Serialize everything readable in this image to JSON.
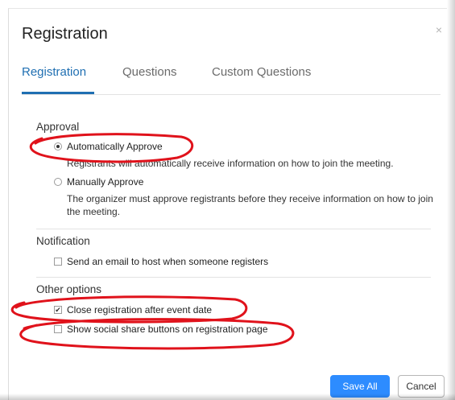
{
  "dialog": {
    "title": "Registration",
    "close_glyph": "×"
  },
  "tabs": [
    {
      "label": "Registration"
    },
    {
      "label": "Questions"
    },
    {
      "label": "Custom Questions"
    }
  ],
  "approval": {
    "label": "Approval",
    "auto": {
      "label": "Automatically Approve",
      "checked": true,
      "description": "Registrants will automatically receive information on how to join the meeting."
    },
    "manual": {
      "label": "Manually Approve",
      "checked": false,
      "description": "The organizer must approve registrants before they receive information on how to join the meeting."
    }
  },
  "notification": {
    "label": "Notification",
    "email_host": {
      "label": "Send an email to host when someone registers",
      "checked": false
    }
  },
  "other_options": {
    "label": "Other options",
    "close_registration": {
      "label": "Close registration after event date",
      "checked": true
    },
    "social_share": {
      "label": "Show social share buttons on registration page",
      "checked": false
    }
  },
  "buttons": {
    "save_all": "Save All",
    "cancel": "Cancel"
  },
  "colors": {
    "accent": "#1f6fb2",
    "primary_button": "#2d8cff",
    "annotation_ring": "#e0121b"
  }
}
